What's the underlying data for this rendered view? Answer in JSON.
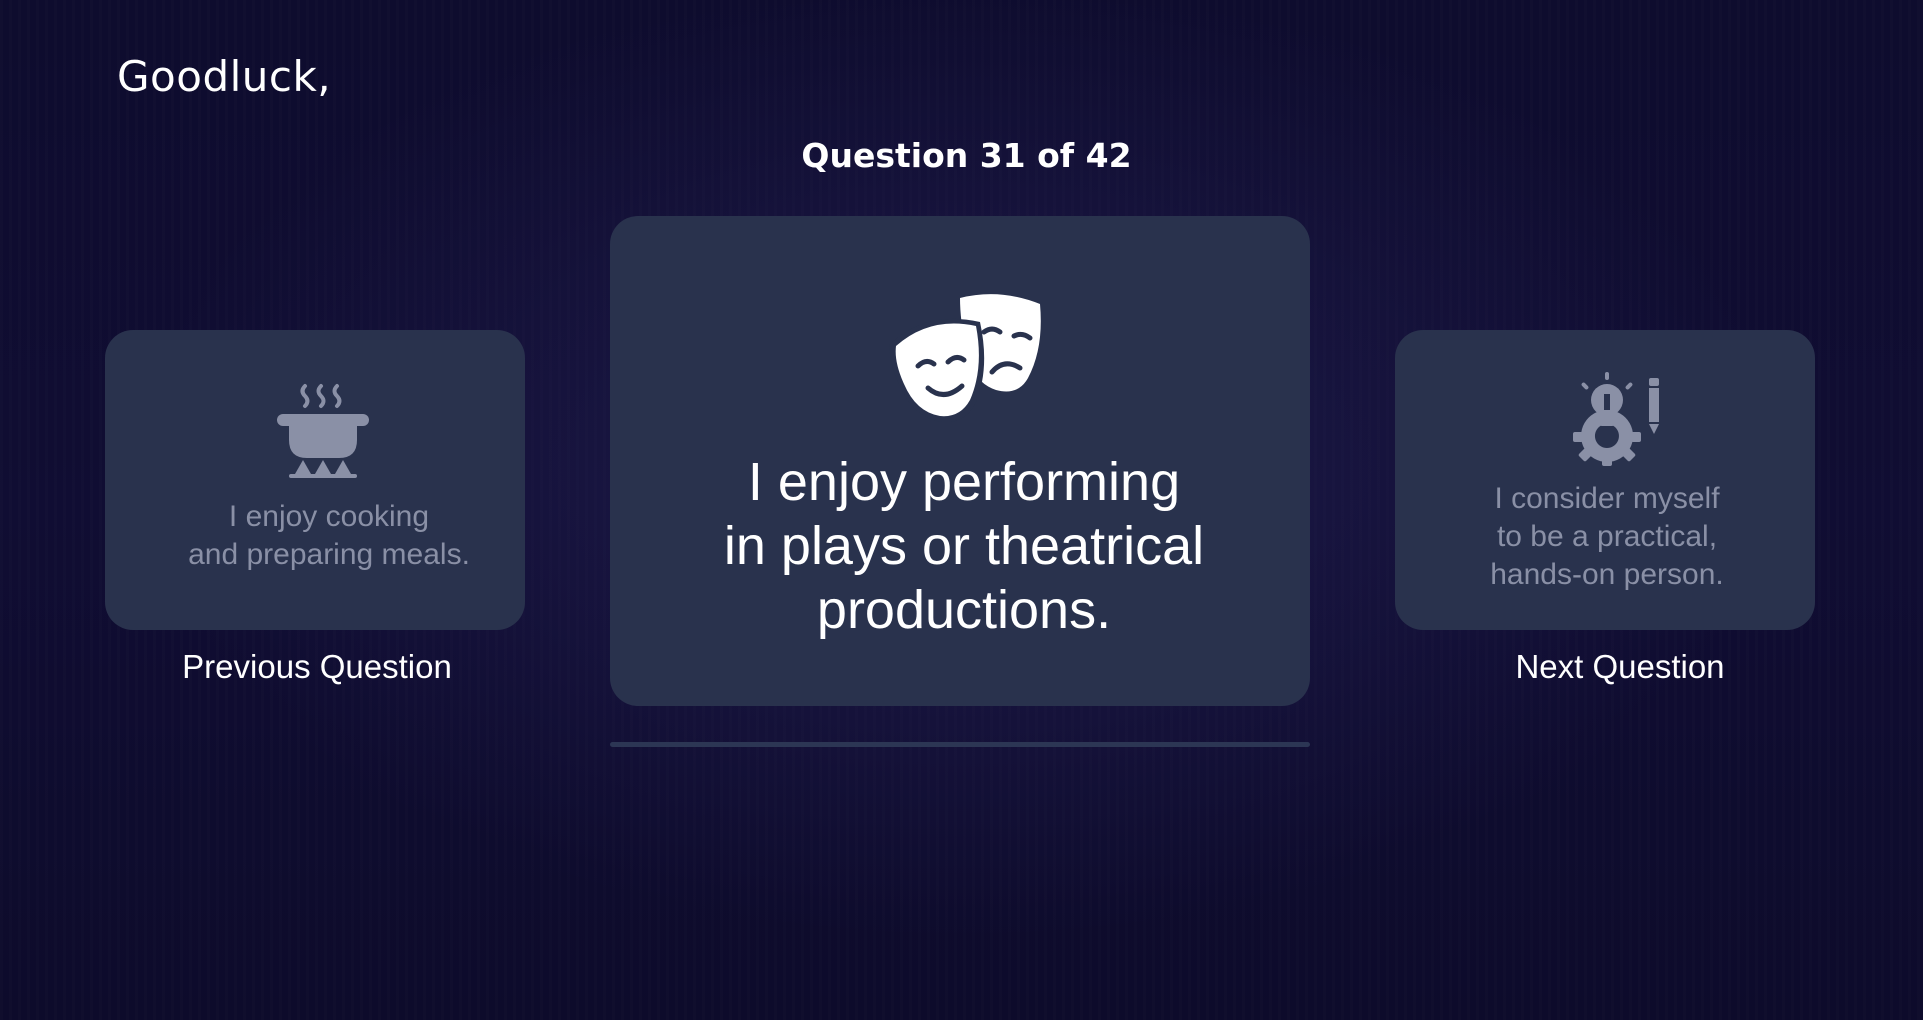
{
  "header": {
    "greeting": "Goodluck,"
  },
  "quiz": {
    "counter": "Question 31 of 42",
    "current_question": {
      "text": "I enjoy performing\nin plays or theatrical\nproductions.",
      "icon": "theater-masks-icon"
    },
    "previous_question": {
      "text": "I enjoy cooking\nand preparing meals.",
      "icon": "cooking-pot-icon"
    },
    "next_question": {
      "text": "I consider myself\nto be a practical,\nhands-on person.",
      "icon": "lightbulb-gear-pencil-icon"
    }
  },
  "nav": {
    "previous_label": "Previous Question",
    "next_label": "Next Question"
  },
  "colors": {
    "background": "#0e0c2e",
    "card": "#29324d",
    "muted_text": "#8a90a6",
    "text": "#ffffff"
  }
}
